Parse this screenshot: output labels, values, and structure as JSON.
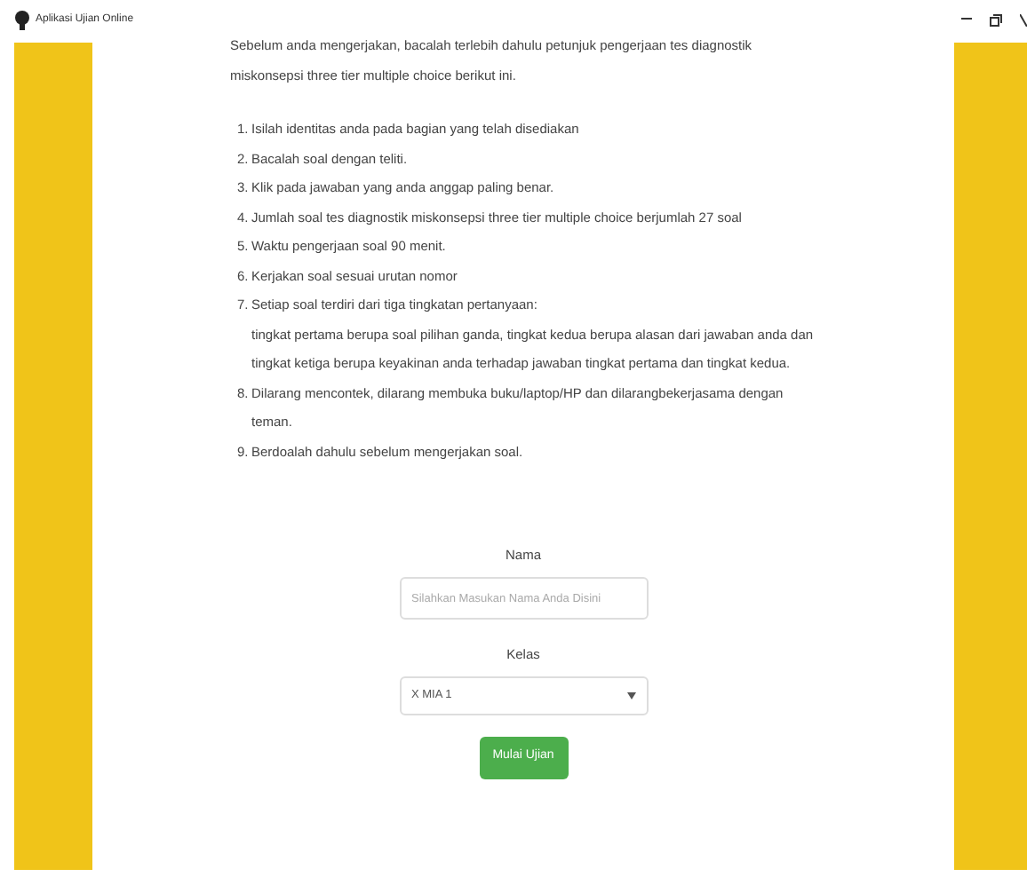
{
  "window": {
    "title": "Aplikasi Ujian Online"
  },
  "intro": "Sebelum anda mengerjakan, bacalah terlebih dahulu petunjuk pengerjaan tes diagnostik miskonsepsi three tier multiple choice berikut ini.",
  "instructions": [
    {
      "number": "1.",
      "text": "Isilah identitas anda pada bagian yang telah disediakan"
    },
    {
      "number": "2.",
      "text": "Bacalah soal dengan teliti."
    },
    {
      "number": "3.",
      "text": "Klik pada jawaban yang anda anggap paling benar."
    },
    {
      "number": "4.",
      "text": "Jumlah soal tes diagnostik miskonsepsi three tier multiple choice berjumlah 27 soal"
    },
    {
      "number": "5.",
      "text": "Waktu pengerjaan soal 90 menit."
    },
    {
      "number": "6.",
      "text": "Kerjakan soal sesuai urutan nomor"
    },
    {
      "number": "7.",
      "text": "Setiap soal terdiri dari tiga tingkatan pertanyaan:",
      "detail": "tingkat pertama berupa soal pilihan ganda, tingkat kedua berupa alasan dari jawaban anda dan tingkat ketiga berupa keyakinan anda terhadap jawaban tingkat pertama dan tingkat kedua."
    },
    {
      "number": "8.",
      "text": "Dilarang mencontek, dilarang membuka buku/laptop/HP dan dilarangbekerjasama dengan teman."
    },
    {
      "number": "9.",
      "text": "Berdoalah dahulu sebelum mengerjakan soal."
    }
  ],
  "form": {
    "name_label": "Nama",
    "name_field": {
      "placeholder": "Silahkan Masukan Nama Anda Disini"
    },
    "class_label": "Kelas",
    "class_select": {
      "value": "X MIA 1"
    },
    "start_button": "Mulai Ujian"
  }
}
